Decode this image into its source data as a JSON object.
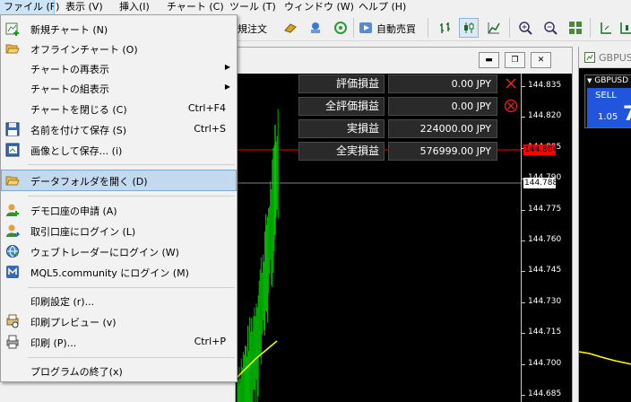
{
  "menubar": {
    "items": [
      "ファイル (F)",
      "表示 (V)",
      "挿入(I)",
      "チャート (C)",
      "ツール (T)",
      "ウィンドウ (W)",
      "ヘルプ (H)"
    ]
  },
  "toolbar": {
    "new_order_label": "規注文",
    "auto_trade_label": "自動売買"
  },
  "file_menu": {
    "items": [
      {
        "label": "新規チャート (N)",
        "shortcut": "",
        "icon": "new-chart-icon"
      },
      {
        "label": "オフラインチャート (O)",
        "shortcut": "",
        "icon": "folder-open-icon"
      },
      {
        "label": "チャートの再表示",
        "shortcut": "",
        "icon": ""
      },
      {
        "label": "チャートの組表示",
        "shortcut": "",
        "icon": ""
      },
      {
        "label": "チャートを閉じる (C)",
        "shortcut": "Ctrl+F4",
        "icon": ""
      },
      {
        "label": "名前を付けて保存 (S)",
        "shortcut": "Ctrl+S",
        "icon": "save-icon"
      },
      {
        "label": "画像として保存... (i)",
        "shortcut": "",
        "icon": "save-image-icon"
      },
      {
        "label": "データフォルダを開く (D)",
        "shortcut": "",
        "icon": "folder-icon"
      },
      {
        "label": "デモ口座の申請 (A)",
        "shortcut": "",
        "icon": "demo-account-icon"
      },
      {
        "label": "取引口座にログイン (L)",
        "shortcut": "",
        "icon": "login-icon"
      },
      {
        "label": "ウェブトレーダーにログイン (W)",
        "shortcut": "",
        "icon": "web-trader-icon"
      },
      {
        "label": "MQL5.community にログイン (M)",
        "shortcut": "",
        "icon": "mql5-icon"
      },
      {
        "label": "印刷設定 (r)...",
        "shortcut": "",
        "icon": ""
      },
      {
        "label": "印刷プレビュー (v)",
        "shortcut": "",
        "icon": "print-preview-icon"
      },
      {
        "label": "印刷 (P)...",
        "shortcut": "Ctrl+P",
        "icon": "print-icon"
      },
      {
        "label": "プログラムの終了(x)",
        "shortcut": "",
        "icon": ""
      }
    ]
  },
  "pnl_panel": {
    "rows": [
      {
        "label": "評価損益",
        "value": "0.00 JPY"
      },
      {
        "label": "全評価損益",
        "value": "0.00 JPY"
      },
      {
        "label": "実損益",
        "value": "224000.00 JPY"
      },
      {
        "label": "全実損益",
        "value": "576999.00 JPY"
      }
    ]
  },
  "price_axis": {
    "labels": [
      "144.835",
      "144.820",
      "144.805",
      "144.790",
      "144.775",
      "144.760",
      "144.745",
      "144.730",
      "144.715",
      "144.700",
      "144.685"
    ],
    "red_line_price": "144.804",
    "white_line_price": "144.788"
  },
  "second_window": {
    "symbol": "GBPUSD",
    "caption": "GBPUS",
    "sell_label": "SELL",
    "price_prefix": "1.05",
    "price_big": "7"
  },
  "colors": {
    "candle": "#00e000",
    "ma_line": "#ffff00",
    "red_line": "#ff0000",
    "highlight": "#c3d9ee",
    "sell_button": "#2255dd"
  }
}
